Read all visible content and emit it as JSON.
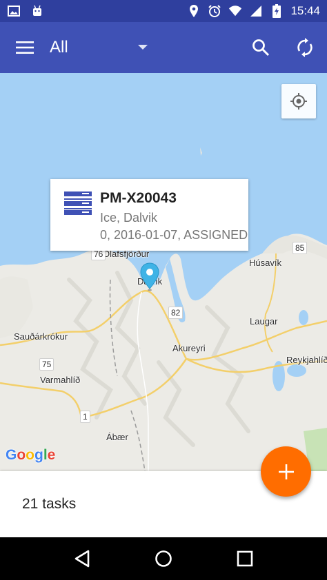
{
  "status_bar": {
    "time": "15:44",
    "left_icons": [
      "image-icon",
      "android-icon"
    ],
    "right_icons": [
      "location-icon",
      "alarm-icon",
      "wifi-icon",
      "signal-icon",
      "battery-charging-icon"
    ]
  },
  "app_bar": {
    "title": "All",
    "background": "#3f51b5",
    "status_background": "#2f3f9e",
    "icons": [
      "menu-icon",
      "dropdown-arrow-icon",
      "search-icon",
      "sync-icon"
    ]
  },
  "map": {
    "places": {
      "olafsfjordur": "Ólafsfjörður",
      "dalvik": "Dalvík",
      "husavik": "Húsavík",
      "saudarkrokur": "Sauðárkrókur",
      "akureyri": "Akureyri",
      "laugar": "Laugar",
      "reykjahlid": "Reykjahlíð",
      "varmahlid": "Varmahlíð",
      "abaer": "Ábær"
    },
    "roads": {
      "r76": "76",
      "r85": "85",
      "r82": "82",
      "r75": "75",
      "r1": "1"
    },
    "attribution": {
      "g1": "G",
      "o1": "o",
      "o2": "o",
      "g2": "g",
      "l": "l",
      "e": "e"
    },
    "colors": {
      "water": "#a4d0f5",
      "land": "#ecebe6",
      "road": "#f3cf6a",
      "marker": "#3fb3e6"
    }
  },
  "info_window": {
    "title": "PM-X20043",
    "line1": "Ice, Dalvik",
    "line2": "0, 2016-01-07, ASSIGNED",
    "icon": "task-list-icon",
    "icon_color": "#3f51b5"
  },
  "bottom_panel": {
    "task_count": "21 tasks"
  },
  "fab": {
    "icon": "plus-icon",
    "color": "#ff6d00"
  },
  "nav_bar": {
    "buttons": [
      "back-icon",
      "home-icon",
      "recents-icon"
    ]
  }
}
